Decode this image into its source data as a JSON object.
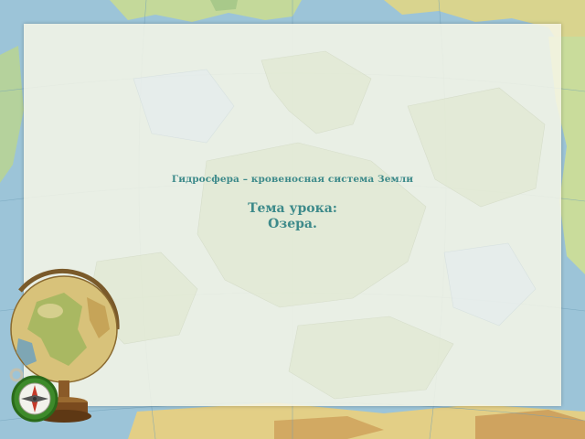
{
  "slide": {
    "subtitle": "Гидросфера – кровеносная система Земли",
    "topic_label": "Тема урока:",
    "topic_name": "Озера."
  },
  "colors": {
    "text": "#3d8a8a",
    "sea": "#9cc4d8",
    "panel": "#f6f6e6",
    "land_green": "#b9d48f",
    "land_yellow": "#e8dc98"
  },
  "decor": {
    "background": "physical-map-frame",
    "illustration": "globe-on-stand-with-compass"
  }
}
